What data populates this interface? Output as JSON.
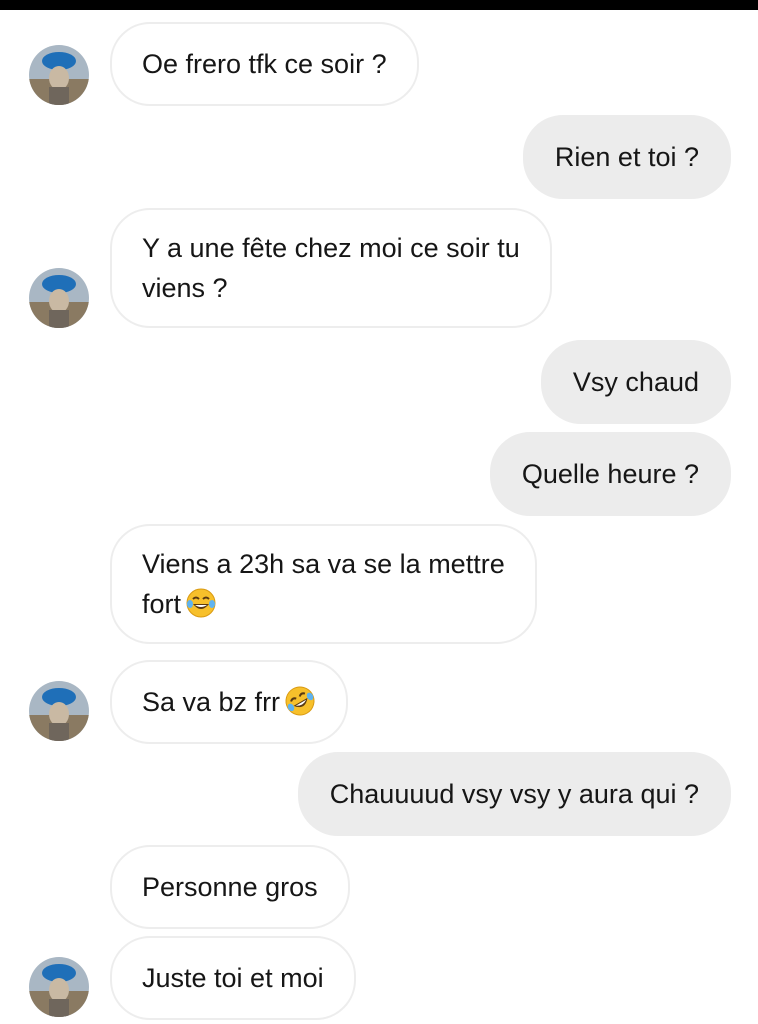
{
  "colors": {
    "incoming_bubble": "#ffffff",
    "incoming_border": "#ededed",
    "outgoing_bubble": "#ececec",
    "text": "#161616",
    "top_bar": "#000000"
  },
  "messages": [
    {
      "from": "them",
      "lines": [
        "Oe frero tfk ce soir ?"
      ],
      "avatar": true
    },
    {
      "from": "me",
      "lines": [
        "Rien et toi ?"
      ]
    },
    {
      "from": "them",
      "lines": [
        "Y a une fête chez moi ce soir tu",
        "viens ?"
      ],
      "avatar": true
    },
    {
      "from": "me",
      "lines": [
        "Vsy chaud"
      ]
    },
    {
      "from": "me",
      "lines": [
        "Quelle heure ?"
      ]
    },
    {
      "from": "them",
      "lines": [
        "Viens a 23h sa va se la mettre",
        "fort"
      ],
      "emoji": "face-with-tears-of-joy"
    },
    {
      "from": "them",
      "lines": [
        "Sa va bz frr"
      ],
      "emoji": "rolling-on-floor-laughing",
      "avatar": true
    },
    {
      "from": "me",
      "lines": [
        "Chauuuud vsy vsy y aura qui ?"
      ]
    },
    {
      "from": "them",
      "lines": [
        "Personne gros"
      ]
    },
    {
      "from": "them",
      "lines": [
        "Juste toi et moi"
      ],
      "avatar": true
    }
  ]
}
